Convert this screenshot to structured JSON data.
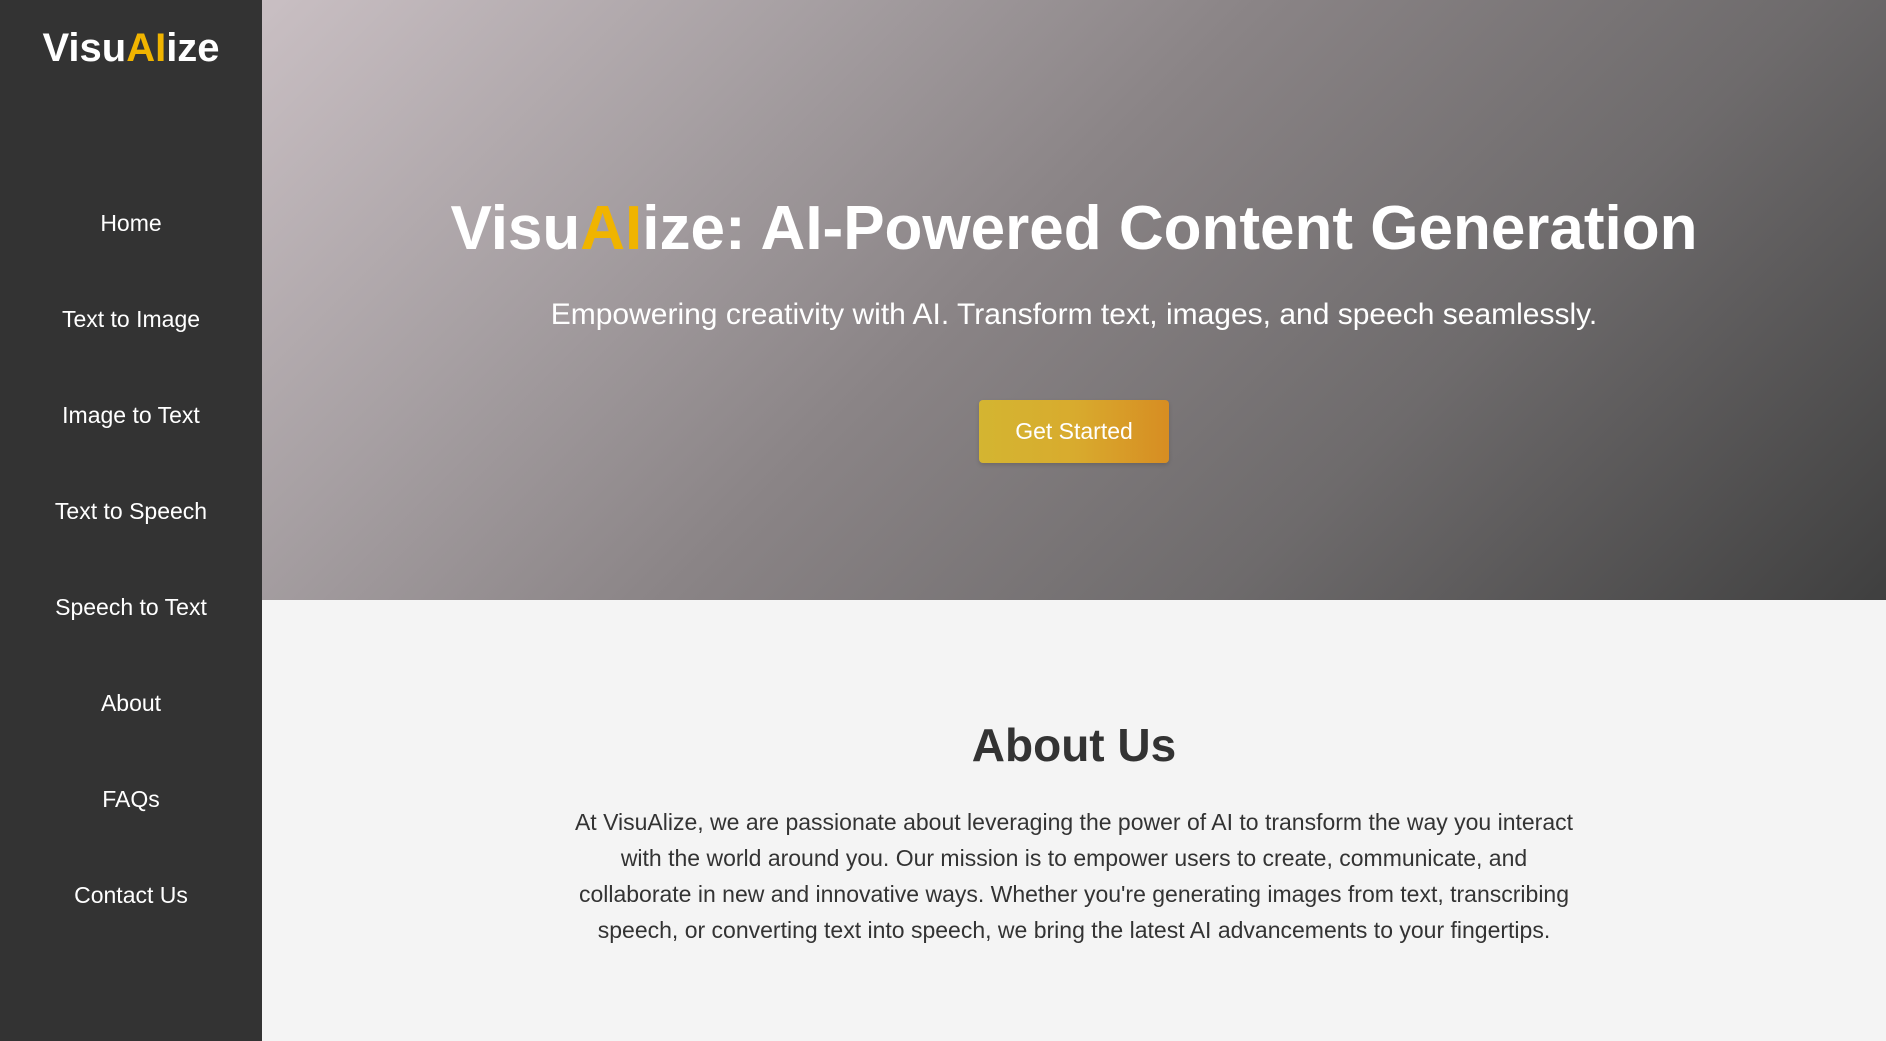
{
  "sidebar": {
    "logo": {
      "part1": "Visu",
      "part2": "AI",
      "part3": "ize"
    },
    "items": [
      {
        "label": "Home"
      },
      {
        "label": "Text to Image"
      },
      {
        "label": "Image to Text"
      },
      {
        "label": "Text to Speech"
      },
      {
        "label": "Speech to Text"
      },
      {
        "label": "About"
      },
      {
        "label": "FAQs"
      },
      {
        "label": "Contact Us"
      }
    ]
  },
  "hero": {
    "title": {
      "part1": "Visu",
      "part2": "AI",
      "part3": "ize: AI-Powered Content Generation"
    },
    "subtitle": "Empowering creativity with AI. Transform text, images, and speech seamlessly.",
    "cta_label": "Get Started"
  },
  "about": {
    "title": "About Us",
    "text": "At VisuAlize, we are passionate about leveraging the power of AI to transform the way you interact with the world around you. Our mission is to empower users to create, communicate, and collaborate in new and innovative ways. Whether you're generating images from text, transcribing speech, or converting text into speech, we bring the latest AI advancements to your fingertips."
  },
  "colors": {
    "sidebar_bg": "#333333",
    "accent": "#f0b400",
    "page_bg": "#f4f4f4",
    "text_dark": "#333333"
  }
}
